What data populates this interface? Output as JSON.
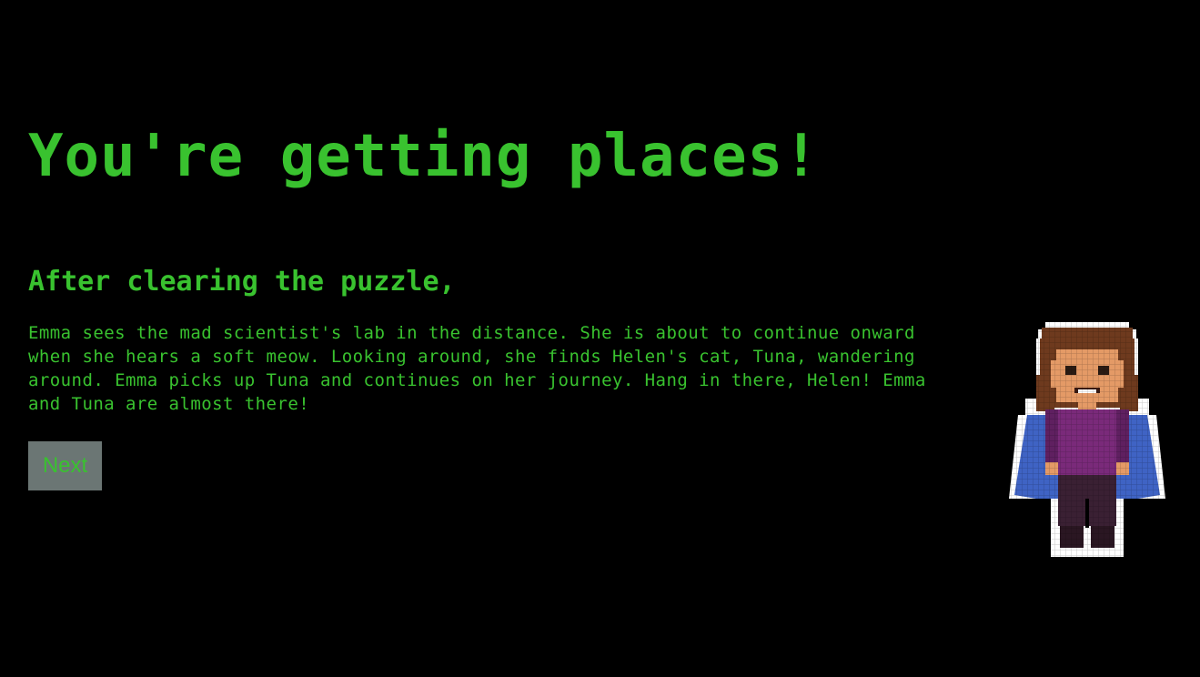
{
  "screen": {
    "headline": "You're getting places!",
    "subheading": "After clearing the puzzle,",
    "story": "Emma sees the mad scientist's lab in the distance. She is about to continue onward when she hears a soft meow. Looking around, she finds Helen's cat, Tuna, wandering around. Emma picks up Tuna and continues on her journey. Hang in there, Helen! Emma and Tuna are almost there!",
    "next_label": "Next"
  },
  "character": {
    "icon": "pixel-hero-emma-icon"
  },
  "colors": {
    "background": "#000000",
    "text": "#39c22f",
    "button_bg": "#6b7674",
    "cape": "#3f63c4",
    "shirt": "#7a2a7a",
    "hair": "#6e3a1e",
    "skin": "#e49a66",
    "pants": "#3a2033"
  }
}
